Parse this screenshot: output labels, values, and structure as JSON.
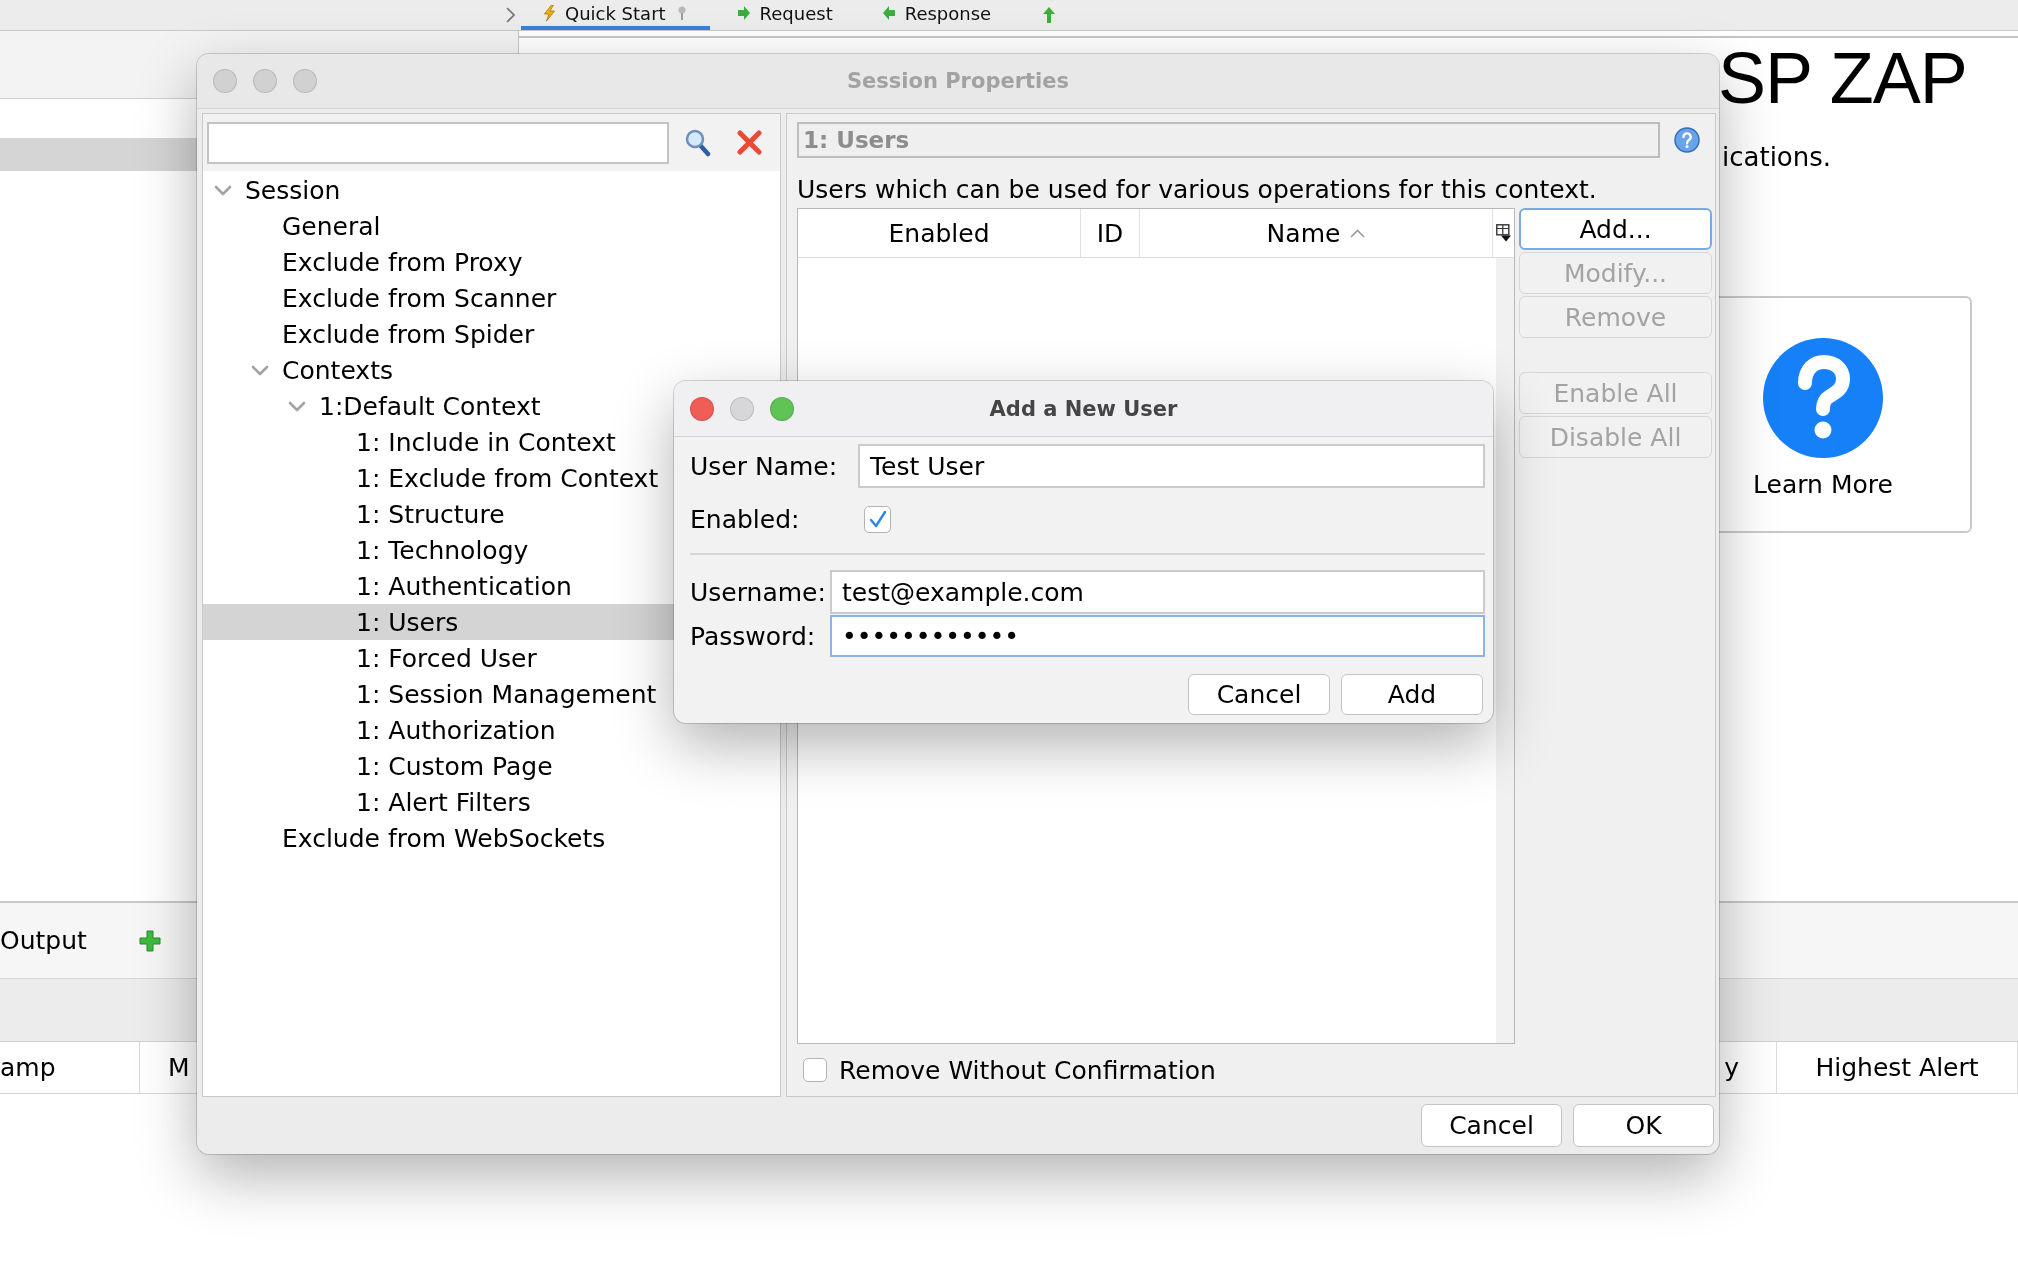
{
  "background_app": {
    "tabs": [
      {
        "label": "Quick Start",
        "selected": true
      },
      {
        "label": "Request",
        "selected": false
      },
      {
        "label": "Response",
        "selected": false
      }
    ],
    "welcome": {
      "heading": "SP ZAP",
      "subtitle": "ications.",
      "card_label": "Learn More"
    },
    "output_panel": {
      "tab_label": "Output"
    },
    "history_table": {
      "columns": [
        "amp",
        "M",
        "y",
        "Highest Alert"
      ]
    }
  },
  "session_dialog": {
    "title": "Session Properties",
    "focused": false,
    "tree": [
      {
        "label": "Session",
        "selected": false,
        "expanded": true,
        "children": [
          {
            "label": "General",
            "selected": false
          },
          {
            "label": "Exclude from Proxy",
            "selected": false
          },
          {
            "label": "Exclude from Scanner",
            "selected": false
          },
          {
            "label": "Exclude from Spider",
            "selected": false
          },
          {
            "label": "Contexts",
            "selected": false,
            "expanded": true,
            "children": [
              {
                "label": "1:Default Context",
                "selected": false,
                "expanded": true,
                "children": [
                  {
                    "label": "1: Include in Context",
                    "selected": false
                  },
                  {
                    "label": "1: Exclude from Context",
                    "selected": false
                  },
                  {
                    "label": "1: Structure",
                    "selected": false
                  },
                  {
                    "label": "1: Technology",
                    "selected": false
                  },
                  {
                    "label": "1: Authentication",
                    "selected": false
                  },
                  {
                    "label": "1: Users",
                    "selected": true
                  },
                  {
                    "label": "1: Forced User",
                    "selected": false
                  },
                  {
                    "label": "1: Session Management",
                    "selected": false
                  },
                  {
                    "label": "1: Authorization",
                    "selected": false
                  },
                  {
                    "label": "1: Custom Page",
                    "selected": false
                  },
                  {
                    "label": "1: Alert Filters",
                    "selected": false
                  }
                ]
              }
            ]
          },
          {
            "label": "Exclude from WebSockets",
            "selected": false
          }
        ]
      }
    ],
    "panel": {
      "title": "1: Users",
      "description": "Users which can be used for various operations for this context.",
      "table": {
        "columns": [
          {
            "label": "Enabled",
            "sorted": false
          },
          {
            "label": "ID",
            "sorted": false
          },
          {
            "label": "Name",
            "sorted": true
          }
        ]
      },
      "row_buttons": [
        {
          "label": "Add...",
          "disabled": false,
          "focused": true
        },
        {
          "label": "Modify...",
          "disabled": true,
          "focused": false
        },
        {
          "label": "Remove",
          "disabled": true,
          "focused": false
        }
      ],
      "bulk_buttons": [
        {
          "label": "Enable All",
          "disabled": true
        },
        {
          "label": "Disable All",
          "disabled": true
        }
      ],
      "remove_without_confirmation": {
        "label": "Remove Without Confirmation",
        "checked": false
      }
    },
    "buttons": [
      "Cancel",
      "OK"
    ]
  },
  "add_user_dialog": {
    "title": "Add a New User",
    "focused": true,
    "user_name": {
      "label": "User Name:",
      "value": "Test User"
    },
    "enabled": {
      "label": "Enabled:",
      "checked": true
    },
    "credentials": [
      {
        "label": "Username:",
        "value": "test@example.com",
        "focused": false
      },
      {
        "label": "Password:",
        "value": "••••••••••••",
        "focused": true
      }
    ],
    "buttons": [
      "Cancel",
      "Add"
    ]
  }
}
